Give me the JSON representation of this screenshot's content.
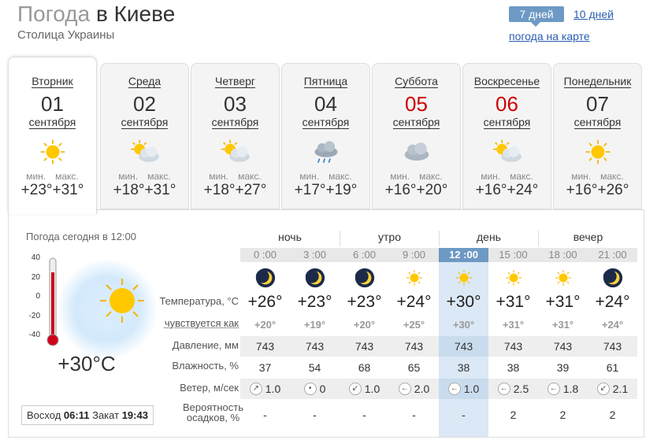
{
  "header": {
    "title_prefix": "Погода",
    "title_city": "в Киеве",
    "subtitle": "Столица Украины"
  },
  "nav": {
    "days7": "7 дней",
    "days10": "10 дней",
    "map": "погода на карте"
  },
  "days": [
    {
      "dow": "Вторник",
      "num": "01",
      "month": "сентября",
      "icon": "sun-icon",
      "min_label": "мин.",
      "max_label": "макс.",
      "min": "+23°",
      "max": "+31°",
      "weekend": false
    },
    {
      "dow": "Среда",
      "num": "02",
      "month": "сентября",
      "icon": "sun-cloud-icon",
      "min_label": "мин.",
      "max_label": "макс.",
      "min": "+18°",
      "max": "+31°",
      "weekend": false
    },
    {
      "dow": "Четверг",
      "num": "03",
      "month": "сентября",
      "icon": "sun-cloud-icon",
      "min_label": "мин.",
      "max_label": "макс.",
      "min": "+18°",
      "max": "+27°",
      "weekend": false
    },
    {
      "dow": "Пятница",
      "num": "04",
      "month": "сентября",
      "icon": "rain-cloud-icon",
      "min_label": "мин.",
      "max_label": "макс.",
      "min": "+17°",
      "max": "+19°",
      "weekend": false
    },
    {
      "dow": "Суббота",
      "num": "05",
      "month": "сентября",
      "icon": "cloud-icon",
      "min_label": "мин.",
      "max_label": "макс.",
      "min": "+16°",
      "max": "+20°",
      "weekend": true
    },
    {
      "dow": "Воскресенье",
      "num": "06",
      "month": "сентября",
      "icon": "sun-cloud-icon",
      "min_label": "мин.",
      "max_label": "макс.",
      "min": "+16°",
      "max": "+24°",
      "weekend": true
    },
    {
      "dow": "Понедельник",
      "num": "07",
      "month": "сентября",
      "icon": "sun-icon",
      "min_label": "мин.",
      "max_label": "макс.",
      "min": "+16°",
      "max": "+26°",
      "weekend": false
    }
  ],
  "today": {
    "label": "Погода сегодня в 12:00",
    "scale": [
      "40",
      "20",
      "0",
      "-20",
      "-40"
    ],
    "current_temp": "+30°C",
    "sunrise_label": "Восход",
    "sunrise": "06:11",
    "sunset_label": "Закат",
    "sunset": "19:43"
  },
  "row_labels": {
    "temp": "Температура, °C",
    "feel": "чувствуется как",
    "press": "Давление, мм",
    "hum": "Влажность, %",
    "wind": "Ветер, м/сек",
    "prec1": "Вероятность",
    "prec2": "осадков, %"
  },
  "periods": [
    "ночь",
    "утро",
    "день",
    "вечер"
  ],
  "hours": [
    {
      "time": "0 :00",
      "icon": "moon-icon",
      "temp": "+26°",
      "feel": "+20°",
      "press": "743",
      "hum": "37",
      "wind_dir": "↗",
      "wind": "1.0",
      "prec": "-"
    },
    {
      "time": "3 :00",
      "icon": "moon-icon",
      "temp": "+23°",
      "feel": "+19°",
      "press": "743",
      "hum": "54",
      "wind_dir": "•",
      "wind": "0",
      "prec": "-"
    },
    {
      "time": "6 :00",
      "icon": "moon-icon",
      "temp": "+23°",
      "feel": "+20°",
      "press": "743",
      "hum": "68",
      "wind_dir": "↙",
      "wind": "1.0",
      "prec": "-"
    },
    {
      "time": "9 :00",
      "icon": "sun-icon",
      "temp": "+24°",
      "feel": "+25°",
      "press": "743",
      "hum": "65",
      "wind_dir": "←",
      "wind": "2.0",
      "prec": "-"
    },
    {
      "time": "12 :00",
      "icon": "sun-icon",
      "temp": "+30°",
      "feel": "+30°",
      "press": "743",
      "hum": "38",
      "wind_dir": "←",
      "wind": "1.0",
      "prec": "-"
    },
    {
      "time": "15 :00",
      "icon": "sun-icon",
      "temp": "+31°",
      "feel": "+31°",
      "press": "743",
      "hum": "38",
      "wind_dir": "←",
      "wind": "2.5",
      "prec": "2"
    },
    {
      "time": "18 :00",
      "icon": "sun-icon",
      "temp": "+31°",
      "feel": "+31°",
      "press": "743",
      "hum": "39",
      "wind_dir": "←",
      "wind": "1.8",
      "prec": "2"
    },
    {
      "time": "21 :00",
      "icon": "moon-icon",
      "temp": "+24°",
      "feel": "+24°",
      "press": "743",
      "hum": "61",
      "wind_dir": "↙",
      "wind": "2.1",
      "prec": "2"
    }
  ],
  "colors": {
    "accent": "#6d99c4",
    "highlight": "#dbe8f5",
    "weekend": "#cc0000",
    "link": "#2a5db0"
  }
}
